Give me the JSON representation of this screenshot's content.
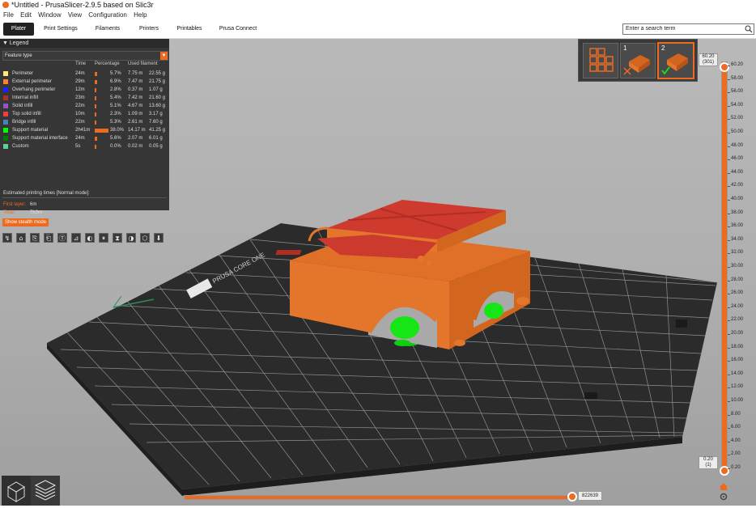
{
  "window": {
    "title": "*Untitled - PrusaSlicer-2.9.5 based on Slic3r"
  },
  "menu": [
    "File",
    "Edit",
    "Window",
    "View",
    "Configuration",
    "Help"
  ],
  "tabs": [
    {
      "label": "Plater",
      "active": true
    },
    {
      "label": "Print Settings",
      "active": false
    },
    {
      "label": "Filaments",
      "active": false
    },
    {
      "label": "Printers",
      "active": false
    },
    {
      "label": "Printables",
      "active": false
    },
    {
      "label": "Prusa Connect",
      "active": false
    }
  ],
  "search": {
    "placeholder": "Enter a search term"
  },
  "legend": {
    "title": "Legend",
    "view_type": "Feature type",
    "columns": {
      "time": "Time",
      "percentage": "Percentage",
      "used": "Used filament"
    },
    "rows": [
      {
        "name": "Perimeter",
        "color": "#ffe680",
        "time": "24m",
        "pct": "5.7%",
        "fraction": 0.057,
        "len": "7.75 m",
        "weight": "22.55 g"
      },
      {
        "name": "External perimeter",
        "color": "#ff7d38",
        "time": "29m",
        "pct": "6.9%",
        "fraction": 0.069,
        "len": "7.47 m",
        "weight": "21.75 g"
      },
      {
        "name": "Overhang perimeter",
        "color": "#1f1fff",
        "time": "12m",
        "pct": "2.8%",
        "fraction": 0.028,
        "len": "0.37 m",
        "weight": "1.07 g"
      },
      {
        "name": "Internal infill",
        "color": "#b03029",
        "time": "23m",
        "pct": "5.4%",
        "fraction": 0.054,
        "len": "7.42 m",
        "weight": "21.60 g"
      },
      {
        "name": "Solid infill",
        "color": "#9654cc",
        "time": "22m",
        "pct": "5.1%",
        "fraction": 0.051,
        "len": "4.67 m",
        "weight": "13.60 g"
      },
      {
        "name": "Top solid infill",
        "color": "#f04040",
        "time": "10m",
        "pct": "2.3%",
        "fraction": 0.023,
        "len": "1.09 m",
        "weight": "3.17 g"
      },
      {
        "name": "Bridge infill",
        "color": "#4d80ba",
        "time": "22m",
        "pct": "5.3%",
        "fraction": 0.053,
        "len": "2.61 m",
        "weight": "7.60 g"
      },
      {
        "name": "Support material",
        "color": "#00ff00",
        "time": "2h41m",
        "pct": "38.0%",
        "fraction": 0.38,
        "len": "14.17 m",
        "weight": "41.25 g"
      },
      {
        "name": "Support material interface",
        "color": "#008000",
        "time": "24m",
        "pct": "5.6%",
        "fraction": 0.056,
        "len": "2.07 m",
        "weight": "6.01 g"
      },
      {
        "name": "Custom",
        "color": "#5ed194",
        "time": "5s",
        "pct": "0.0%",
        "fraction": 0.0,
        "len": "0.02 m",
        "weight": "0.05 g"
      }
    ],
    "estimated_label": "Estimated printing times [Normal mode]:",
    "first_layer_label": "First layer:",
    "first_layer_value": "6m",
    "total_label": "Total:",
    "total_value": "7h3m",
    "stealth_button": "Show stealth mode",
    "toolbar_icons": [
      "travel-icon",
      "wipe-icon",
      "retractions-icon",
      "deretractions-icon",
      "seams-icon",
      "tool-changes-icon",
      "color-changes-icon",
      "pause-icon",
      "custom-gcode-icon",
      "center-of-gravity-icon",
      "shells-icon",
      "tool-marker-icon"
    ]
  },
  "plate_thumbs": [
    {
      "label": "",
      "state": "arrange"
    },
    {
      "label": "1",
      "state": "unsliced"
    },
    {
      "label": "2",
      "state": "selected"
    }
  ],
  "layer_slider": {
    "top_label": "60.20",
    "top_sub": "(301)",
    "bottom_label": "0.20",
    "bottom_sub": "(1)",
    "ticks": [
      "60.20",
      "58.00",
      "56.00",
      "54.00",
      "52.00",
      "50.00",
      "48.00",
      "46.00",
      "44.00",
      "42.00",
      "40.00",
      "38.00",
      "36.00",
      "34.00",
      "32.00",
      "30.00",
      "28.00",
      "26.00",
      "24.00",
      "22.00",
      "20.00",
      "18.00",
      "16.00",
      "14.00",
      "12.00",
      "10.00",
      "8.00",
      "6.00",
      "4.00",
      "2.00",
      "0.20"
    ]
  },
  "move_slider": {
    "value": "822639"
  },
  "bed": {
    "logo_text": "PRUSA CORE ONE"
  },
  "colors": {
    "accent": "#ed6b21",
    "model": "#e8762c",
    "top": "#cf3a2e",
    "support": "#16e616"
  }
}
